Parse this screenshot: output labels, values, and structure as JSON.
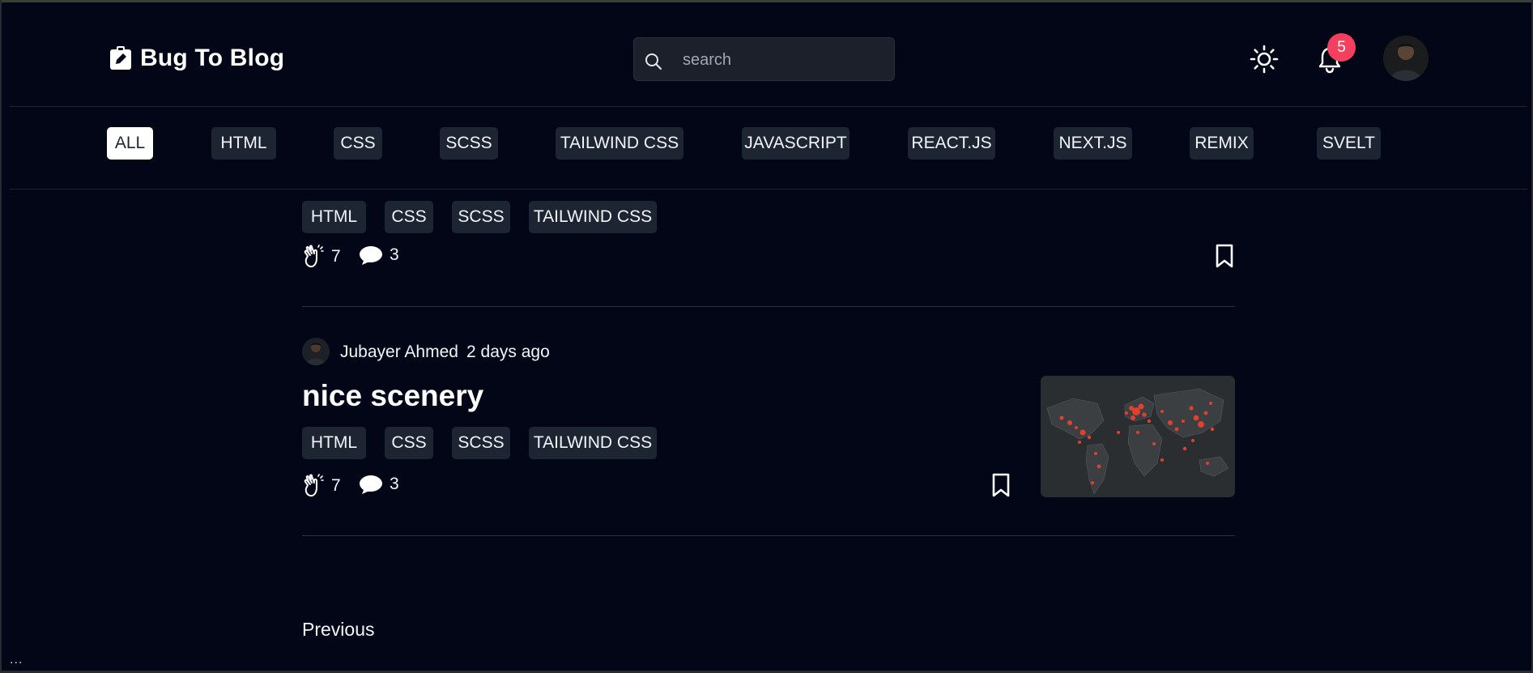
{
  "header": {
    "logo_text": "Bug To Blog",
    "search_placeholder": "search",
    "notification_count": "5"
  },
  "categories": [
    {
      "label": "ALL",
      "active": true
    },
    {
      "label": "HTML"
    },
    {
      "label": "CSS"
    },
    {
      "label": "SCSS"
    },
    {
      "label": "TAILWIND CSS"
    },
    {
      "label": "JAVASCRIPT"
    },
    {
      "label": "REACT.JS"
    },
    {
      "label": "NEXT.JS"
    },
    {
      "label": "REMIX"
    },
    {
      "label": "SVELT"
    }
  ],
  "posts": [
    {
      "tags": [
        "HTML",
        "CSS",
        "SCSS",
        "TAILWIND CSS"
      ],
      "claps": "7",
      "comments": "3"
    },
    {
      "author": "Jubayer Ahmed",
      "time": "2 days ago",
      "title": "nice scenery",
      "tags": [
        "HTML",
        "CSS",
        "SCSS",
        "TAILWIND CSS"
      ],
      "claps": "7",
      "comments": "3"
    }
  ],
  "pagination": {
    "previous_label": "Previous"
  },
  "footer": {
    "overflow_text": "..."
  },
  "colors": {
    "background": "#030617",
    "chip": "#1e2532",
    "badge": "#f43f5e",
    "accent_marker": "#e0402f"
  }
}
